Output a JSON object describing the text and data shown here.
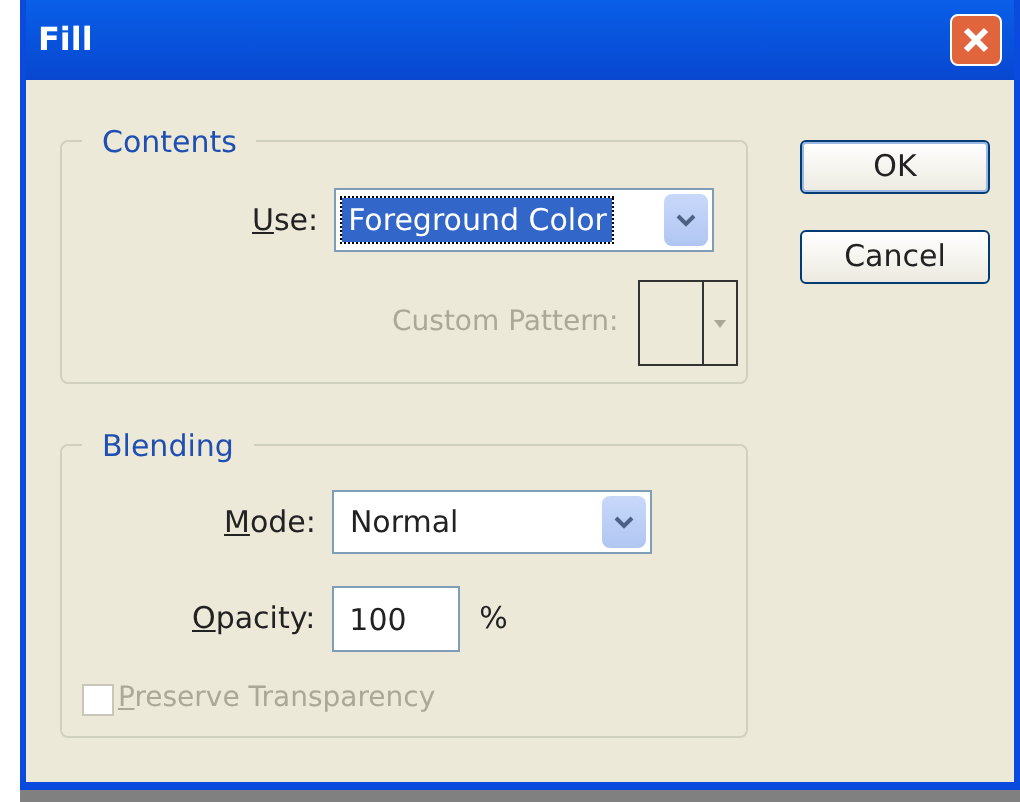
{
  "window": {
    "title": "Fill"
  },
  "contents": {
    "title": "Contents",
    "use": {
      "label": "Use:",
      "mnemonic_underlined": true,
      "value": "Foreground Color",
      "focused": true
    },
    "custom_pattern": {
      "label": "Custom Pattern:",
      "disabled": true
    }
  },
  "blending": {
    "title": "Blending",
    "mode": {
      "label": "Mode:",
      "mnemonic_underlined": true,
      "value": "Normal"
    },
    "opacity": {
      "label": "Opacity:",
      "mnemonic_underlined": true,
      "value": "100",
      "unit": "%"
    },
    "preserve_transparency": {
      "label": "Preserve Transparency",
      "mnemonic_underlined": true,
      "checked": false,
      "disabled": true
    }
  },
  "buttons": [
    {
      "label": "OK",
      "default": true
    },
    {
      "label": "Cancel",
      "default": false
    }
  ]
}
